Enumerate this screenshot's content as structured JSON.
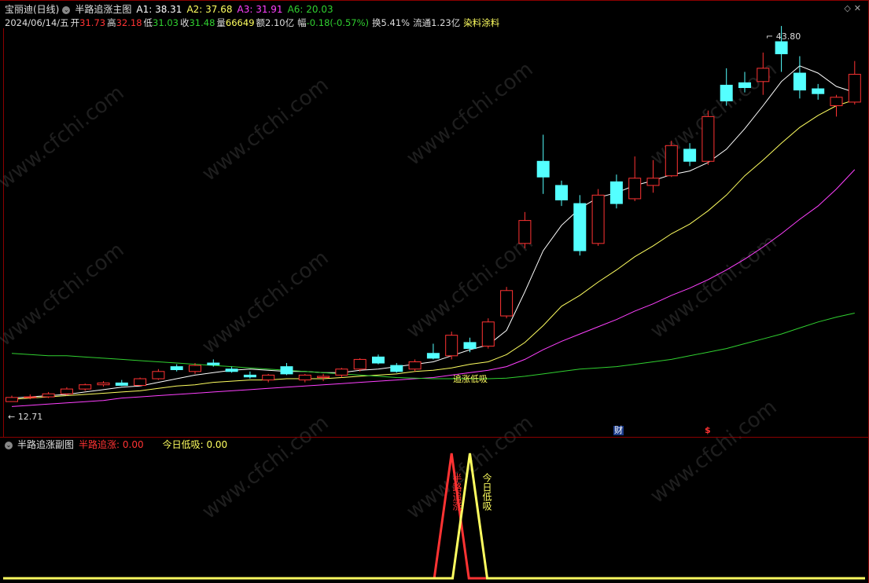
{
  "header": {
    "name": "宝丽迪(日线)",
    "indicator": "半路追涨主图",
    "a1": "A1: 38.31",
    "a2": "A2: 37.68",
    "a3": "A3: 31.91",
    "a6": "A6: 20.03",
    "date": "2024/06/14/五",
    "open_label": "开",
    "open": "31.73",
    "high_label": "高",
    "high": "32.18",
    "low_label": "低",
    "low": "31.03",
    "close_label": "收",
    "close": "31.48",
    "vol_label": "量",
    "vol": "66649",
    "amount": "额2.10亿",
    "change_label": "幅",
    "change": "-0.18(-0.57%)",
    "turnover": "换5.41%",
    "float": "流通1.23亿",
    "sector": "染料涂料"
  },
  "main": {
    "max_label": "43.80",
    "min_label": "12.71",
    "signal_label": "追涨低吸",
    "cai_label": "财",
    "dollar_label": "$"
  },
  "sub": {
    "indicator": "半路追涨副图",
    "value1": "半路追涨: 0.00",
    "value2": "今日低吸: 0.00",
    "peak1_label": "半路追涨",
    "peak2_label": "今日低吸"
  },
  "watermark": "www.cfchi.com",
  "colors": {
    "up": "#ff3333",
    "down": "#54ffff",
    "ma1": "#ffffff",
    "ma2": "#ffff60",
    "ma3": "#ff40ff",
    "ma4": "#30d030"
  },
  "chart_data": {
    "type": "candlestick",
    "ylim": [
      12,
      44
    ],
    "candles": [
      [
        12.71,
        13.2,
        12.71,
        13.05
      ],
      [
        13.05,
        13.3,
        12.9,
        13.1
      ],
      [
        13.1,
        13.5,
        13.0,
        13.35
      ],
      [
        13.35,
        13.9,
        13.2,
        13.75
      ],
      [
        13.75,
        14.2,
        13.6,
        14.1
      ],
      [
        14.1,
        14.4,
        13.95,
        14.25
      ],
      [
        14.25,
        14.5,
        14.0,
        14.05
      ],
      [
        14.05,
        14.7,
        14.0,
        14.6
      ],
      [
        14.6,
        15.4,
        14.5,
        15.2
      ],
      [
        15.6,
        15.8,
        15.2,
        15.35
      ],
      [
        15.2,
        15.9,
        15.0,
        15.7
      ],
      [
        15.9,
        16.2,
        15.6,
        15.75
      ],
      [
        15.4,
        15.6,
        15.1,
        15.2
      ],
      [
        14.9,
        15.2,
        14.6,
        14.75
      ],
      [
        14.5,
        15.0,
        14.3,
        14.9
      ],
      [
        15.6,
        15.9,
        14.9,
        15.0
      ],
      [
        14.5,
        15.0,
        14.3,
        14.9
      ],
      [
        14.7,
        15.0,
        14.4,
        14.8
      ],
      [
        14.9,
        15.5,
        14.7,
        15.4
      ],
      [
        15.4,
        16.3,
        15.2,
        16.2
      ],
      [
        16.4,
        16.6,
        15.8,
        15.9
      ],
      [
        15.7,
        15.9,
        15.1,
        15.2
      ],
      [
        15.4,
        16.2,
        15.2,
        16.0
      ],
      [
        16.7,
        17.5,
        16.2,
        16.3
      ],
      [
        16.5,
        18.5,
        16.2,
        18.2
      ],
      [
        17.6,
        18.0,
        16.8,
        17.1
      ],
      [
        17.3,
        19.6,
        17.1,
        19.3
      ],
      [
        19.8,
        22.2,
        19.6,
        21.9
      ],
      [
        25.8,
        28.4,
        25.4,
        27.7
      ],
      [
        32.6,
        34.8,
        29.9,
        31.3
      ],
      [
        30.6,
        31.0,
        28.9,
        29.4
      ],
      [
        29.1,
        29.8,
        24.8,
        25.2
      ],
      [
        25.8,
        30.3,
        25.6,
        29.8
      ],
      [
        30.9,
        31.5,
        28.7,
        29.1
      ],
      [
        29.5,
        33.0,
        29.3,
        31.2
      ],
      [
        30.6,
        32.7,
        30.0,
        31.2
      ],
      [
        31.4,
        34.3,
        31.3,
        33.9
      ],
      [
        33.6,
        34.1,
        32.2,
        32.6
      ],
      [
        32.6,
        36.8,
        32.3,
        36.3
      ],
      [
        38.9,
        40.3,
        37.2,
        37.6
      ],
      [
        39.1,
        40.0,
        38.3,
        38.7
      ],
      [
        39.2,
        41.6,
        38.1,
        40.3
      ],
      [
        42.5,
        43.8,
        40.0,
        41.5
      ],
      [
        39.9,
        41.3,
        37.8,
        38.5
      ],
      [
        38.6,
        39.0,
        37.7,
        38.2
      ],
      [
        37.2,
        38.1,
        36.3,
        37.9
      ],
      [
        37.5,
        40.9,
        37.3,
        39.8
      ]
    ],
    "series": [
      {
        "name": "A1",
        "values": [
          13.0,
          13.1,
          13.2,
          13.3,
          13.5,
          13.7,
          13.9,
          14.0,
          14.3,
          14.6,
          14.9,
          15.1,
          15.3,
          15.4,
          15.3,
          15.2,
          15.2,
          15.1,
          15.1,
          15.3,
          15.4,
          15.6,
          15.8,
          16.0,
          16.5,
          17.0,
          17.4,
          18.6,
          21.8,
          25.2,
          27.3,
          28.7,
          29.6,
          30.0,
          30.6,
          31.0,
          31.5,
          31.8,
          32.5,
          33.6,
          35.3,
          37.2,
          39.2,
          40.5,
          39.9,
          38.8,
          38.31
        ]
      },
      {
        "name": "A2",
        "values": [
          12.9,
          13.0,
          13.1,
          13.2,
          13.3,
          13.4,
          13.5,
          13.6,
          13.8,
          14.0,
          14.1,
          14.3,
          14.4,
          14.5,
          14.5,
          14.6,
          14.6,
          14.6,
          14.7,
          14.8,
          14.9,
          15.0,
          15.2,
          15.3,
          15.5,
          15.8,
          16.0,
          16.6,
          17.6,
          19.0,
          20.6,
          21.5,
          22.6,
          23.6,
          24.7,
          25.6,
          26.6,
          27.4,
          28.5,
          29.8,
          31.4,
          32.7,
          34.1,
          35.4,
          36.4,
          37.2,
          37.68
        ]
      },
      {
        "name": "A3",
        "values": [
          12.3,
          12.4,
          12.5,
          12.6,
          12.7,
          12.8,
          13.0,
          13.1,
          13.2,
          13.3,
          13.4,
          13.5,
          13.6,
          13.7,
          13.8,
          13.9,
          14.0,
          14.1,
          14.2,
          14.3,
          14.4,
          14.5,
          14.6,
          14.7,
          14.9,
          15.1,
          15.3,
          15.6,
          16.2,
          17.0,
          17.7,
          18.3,
          18.9,
          19.5,
          20.2,
          20.8,
          21.5,
          22.1,
          22.8,
          23.6,
          24.5,
          25.5,
          26.6,
          27.8,
          28.9,
          30.3,
          31.91
        ]
      },
      {
        "name": "A6",
        "values": [
          16.7,
          16.6,
          16.5,
          16.5,
          16.4,
          16.3,
          16.2,
          16.1,
          16.0,
          15.9,
          15.8,
          15.7,
          15.6,
          15.5,
          15.4,
          15.3,
          15.2,
          15.1,
          15.0,
          14.9,
          14.8,
          14.7,
          14.65,
          14.6,
          14.6,
          14.6,
          14.6,
          14.65,
          14.8,
          15.0,
          15.2,
          15.4,
          15.5,
          15.6,
          15.8,
          16.0,
          16.2,
          16.5,
          16.8,
          17.1,
          17.5,
          17.9,
          18.3,
          18.8,
          19.3,
          19.7,
          20.03
        ]
      }
    ],
    "sub_series": [
      {
        "name": "半路追涨",
        "peak_index": 24,
        "values": "0 except peak 1 at one bar"
      },
      {
        "name": "今日低吸",
        "peak_index": 25,
        "values": "0 except peak 1 at one bar"
      }
    ]
  }
}
